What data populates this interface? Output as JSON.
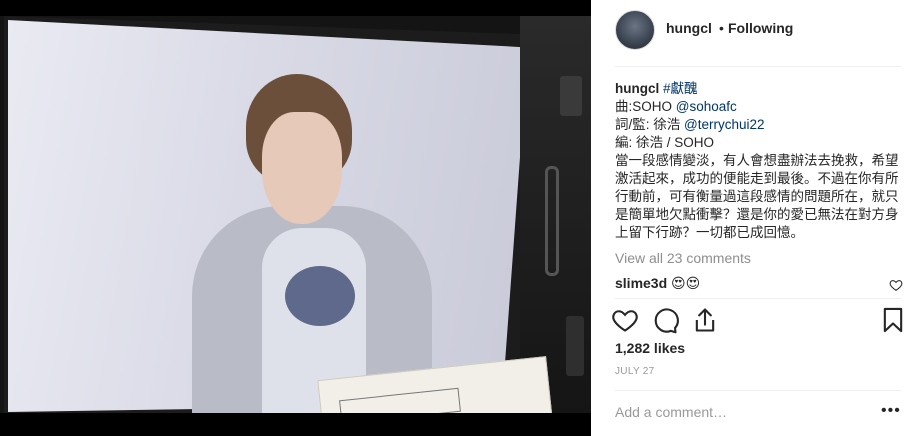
{
  "post": {
    "author": "hungcl",
    "dot": "•",
    "follow_status": "Following"
  },
  "caption": {
    "author": "hungcl",
    "hashtag": "#獻醜",
    "line2_prefix": "曲:SOHO ",
    "line2_mention": "@sohoafc",
    "line3_prefix": "詞/監: 徐浩 ",
    "line3_mention": "@terrychui22",
    "line4": "編: 徐浩 / SOHO",
    "body": "當一段感情變淡，有人會想盡辦法去挽救，希望激活起來，成功的便能走到最後。不過在你有所行動前，可有衡量過這段感情的問題所在，就只是簡單地欠點衝擊？還是你的愛已無法在對方身上留下行跡？一切都已成回憶。"
  },
  "comments": {
    "view_all": "View all 23 comments",
    "items": [
      {
        "user": "slime3d",
        "text": "😍😍"
      }
    ]
  },
  "stats": {
    "likes": "1,282 likes",
    "date": "JULY 27"
  },
  "composer": {
    "placeholder": "Add a comment…",
    "more": "•••"
  },
  "icons": {
    "like": "heart-icon",
    "comment": "speech-bubble-icon",
    "share": "share-icon",
    "save": "bookmark-icon",
    "comment_like": "heart-icon"
  }
}
